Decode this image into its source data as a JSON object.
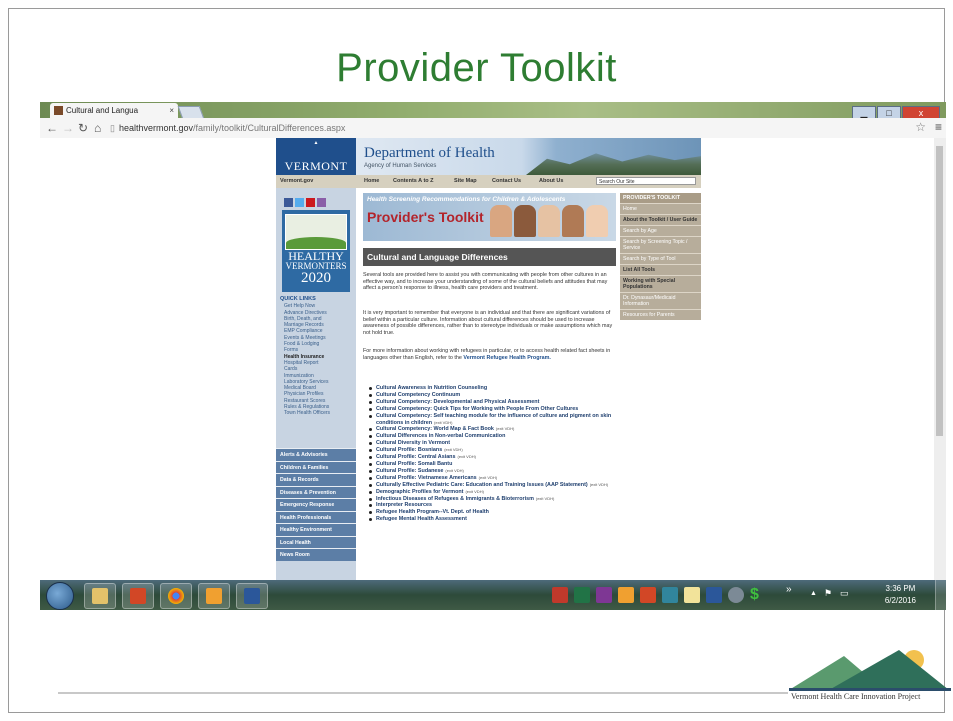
{
  "slide": {
    "title": "Provider Toolkit",
    "logo_caption": "Vermont Health Care Innovation Project"
  },
  "browser": {
    "tab_title": "Cultural and Langua",
    "tab_close": "×",
    "url_host": "healthvermont.gov",
    "url_path": "/family/toolkit/CulturalDifferences.aspx",
    "win_min": "▁",
    "win_max": "□",
    "win_close": "x"
  },
  "site": {
    "logo_text": "VERMONT",
    "dept_title": "Department of Health",
    "dept_subtitle": "Agency of Human Services",
    "topnav": [
      "Vermont.gov",
      "Home",
      "Contents A to Z",
      "Site Map",
      "Contact Us",
      "About Us"
    ],
    "search_placeholder": "Search Our Site",
    "healthy_vermonters": [
      "HEALTHY",
      "VERMONTERS",
      "2020"
    ],
    "quick_links_heading": "QUICK LINKS",
    "quick_links": [
      "Get Help Now",
      "Advance Directives",
      "Birth, Death, and",
      "Marriage Records",
      "EMP Compliance",
      "Events & Meetings",
      "Food & Lodging",
      "Forms",
      "Health Insurance",
      "Hospital Report",
      "Cards",
      "Immunization",
      "Laboratory Services",
      "Medical Board",
      "Physician Profiles",
      "Restaurant Scores",
      "Rules & Regulations",
      "Town Health Officers"
    ],
    "categories": [
      "Alerts & Advisories",
      "Children & Families",
      "Data & Records",
      "Diseases & Prevention",
      "Emergency Response",
      "Health Professionals",
      "Healthy Environment",
      "Local Health",
      "News Room"
    ],
    "banner_tagline": "Health Screening Recommendations for Children & Adolescents",
    "banner_title": "Provider's Toolkit",
    "section_heading": "Cultural and Language Differences",
    "para1": "Several tools are provided here to assist you with communicating with people from other cultures in an effective way, and to increase your understanding of some of the cultural beliefs and attitudes that may affect a person's response to illness, health care providers and treatment.",
    "para2": "It is very important to remember that everyone is an individual and that there are significant variations of belief within a particular culture. Information about cultural differences should be used to increase awareness of possible differences, rather than to stereotype individuals or make assumptions which may not hold true.",
    "para3_text": "For more information about working with refugees in particular, or to access health related fact sheets in languages other than English, refer to the ",
    "para3_link": "Vermont Refugee Health Program.",
    "links": [
      {
        "text": "Cultural Awareness in Nutrition Counseling",
        "ext": ""
      },
      {
        "text": "Cultural Competency Continuum",
        "ext": ""
      },
      {
        "text": "Cultural Competency: Developmental and Physical Assessment",
        "ext": ""
      },
      {
        "text": "Cultural Competency: Quick Tips for Working with People From Other Cultures",
        "ext": ""
      },
      {
        "text": "Cultural Competency: Self teaching module for the influence of culture and pigment on skin conditions in children",
        "ext": "(exit VDH)"
      },
      {
        "text": "Cultural Competency: World Map & Fact Book",
        "ext": "(exit VDH)"
      },
      {
        "text": "Cultural Differences in Non-verbal Communication",
        "ext": ""
      },
      {
        "text": "Cultural Diversity in Vermont",
        "ext": ""
      },
      {
        "text": "Cultural Profile: Bosnians",
        "ext": "(exit VDH)"
      },
      {
        "text": "Cultural Profile: Central Asians",
        "ext": "(exit VDH)"
      },
      {
        "text": "Cultural Profile: Somali Bantu",
        "ext": ""
      },
      {
        "text": "Cultural Profile: Sudanese",
        "ext": "(exit VDH)"
      },
      {
        "text": "Cultural Profile: Vietnamese Americans",
        "ext": "(exit VDH)"
      },
      {
        "text": "Culturally Effective Pediatric Care: Education and Training Issues (AAP Statement)",
        "ext": "(exit VDH)"
      },
      {
        "text": "Demographic Profiles for Vermont",
        "ext": "(exit VDH)"
      },
      {
        "text": "Infectious Diseases of Refugees & Immigrants & Bioterrorism",
        "ext": "(exit VDH)"
      },
      {
        "text": "Interpreter Resources",
        "ext": ""
      },
      {
        "text": "Refugee Health Program--Vt. Dept. of Health",
        "ext": ""
      },
      {
        "text": "Refugee Mental Health Assessment",
        "ext": ""
      }
    ],
    "toolkit_heading": "PROVIDER'S TOOLKIT",
    "toolkit_items": [
      {
        "label": "Home",
        "hl": false
      },
      {
        "label": "About the Toolkit / User Guide",
        "hl": true
      },
      {
        "label": "Search by Age",
        "hl": false
      },
      {
        "label": "Search by Screening Topic / Service",
        "hl": false
      },
      {
        "label": "Search by Type of Tool",
        "hl": false
      },
      {
        "label": "List All Tools",
        "hl": true
      },
      {
        "label": "Working with Special Populations",
        "hl": true
      },
      {
        "label": "Dr. Dynasaur/Medicaid Information",
        "hl": false
      },
      {
        "label": "Resources for Parents",
        "hl": false
      }
    ]
  },
  "taskbar": {
    "time": "3:36 PM",
    "date": "6/2/2016",
    "overflow": "»"
  },
  "colors": {
    "title_green": "#2e7d32",
    "vermont_blue": "#1f4f8c",
    "banner_red": "#b3242b"
  }
}
